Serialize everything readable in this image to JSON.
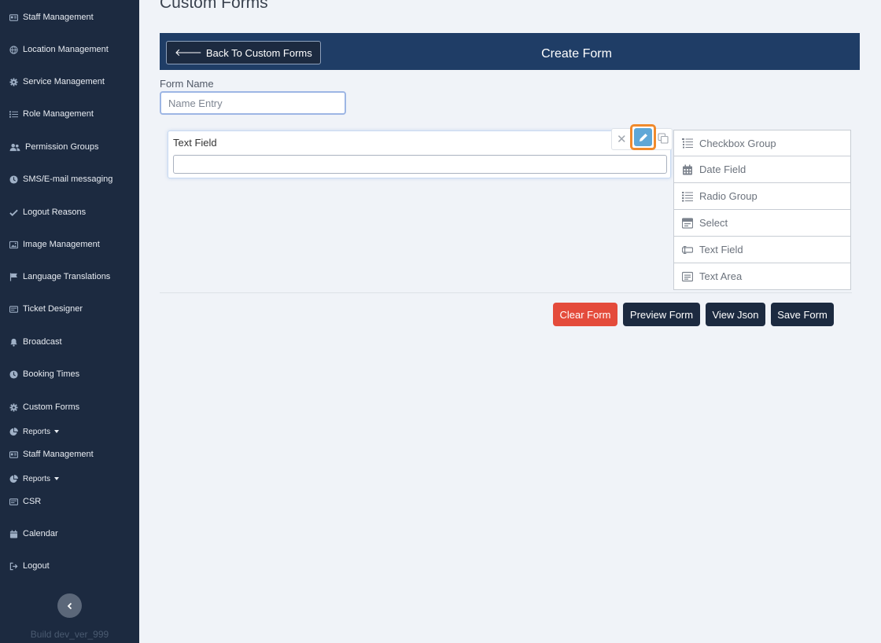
{
  "sidebar": {
    "items": [
      {
        "label": "Staff Management",
        "icon": "id-card-icon"
      },
      {
        "label": "Location Management",
        "icon": "globe-icon"
      },
      {
        "label": "Service Management",
        "icon": "gear-icon"
      },
      {
        "label": "Role Management",
        "icon": "list-icon"
      },
      {
        "label": "Permission Groups",
        "icon": "users-icon"
      },
      {
        "label": "SMS/E-mail messaging",
        "icon": "clock-icon"
      },
      {
        "label": "Logout Reasons",
        "icon": "check-icon"
      },
      {
        "label": "Image Management",
        "icon": "image-icon"
      },
      {
        "label": "Language Translations",
        "icon": "flag-icon"
      },
      {
        "label": "Ticket Designer",
        "icon": "ticket-icon"
      },
      {
        "label": "Broadcast",
        "icon": "bell-icon"
      },
      {
        "label": "Booking Times",
        "icon": "clock-icon"
      },
      {
        "label": "Custom Forms",
        "icon": "gear-icon"
      },
      {
        "label": "Reports",
        "icon": "pie-chart-icon"
      },
      {
        "label": "Staff Management",
        "icon": "id-card-icon"
      },
      {
        "label": "Reports",
        "icon": "pie-chart-icon"
      },
      {
        "label": "CSR",
        "icon": "id-card-icon"
      },
      {
        "label": "Calendar",
        "icon": "calendar-icon"
      },
      {
        "label": "Logout",
        "icon": "sign-out-icon"
      }
    ],
    "build": "Build dev_ver_999"
  },
  "page": {
    "title": "Custom Forms"
  },
  "header": {
    "back_label": "Back To Custom Forms",
    "title": "Create Form"
  },
  "form": {
    "name_label": "Form Name",
    "name_placeholder": "Name Entry",
    "field_title": "Text Field"
  },
  "palette": {
    "items": [
      {
        "label": "Checkbox Group",
        "icon": "checklist-icon"
      },
      {
        "label": "Date Field",
        "icon": "calendar-icon"
      },
      {
        "label": "Radio Group",
        "icon": "list-icon"
      },
      {
        "label": "Select",
        "icon": "select-icon"
      },
      {
        "label": "Text Field",
        "icon": "text-field-icon"
      },
      {
        "label": "Text Area",
        "icon": "text-area-icon"
      }
    ]
  },
  "actions": {
    "clear": "Clear Form",
    "preview": "Preview Form",
    "json": "View Json",
    "save": "Save Form"
  },
  "colors": {
    "sidebar_bg": "#1c2a40",
    "header_bg": "#1f3d66",
    "danger": "#e44b3b",
    "edit_highlight": "#f08a2c",
    "edit_button": "#5fa7d7"
  }
}
